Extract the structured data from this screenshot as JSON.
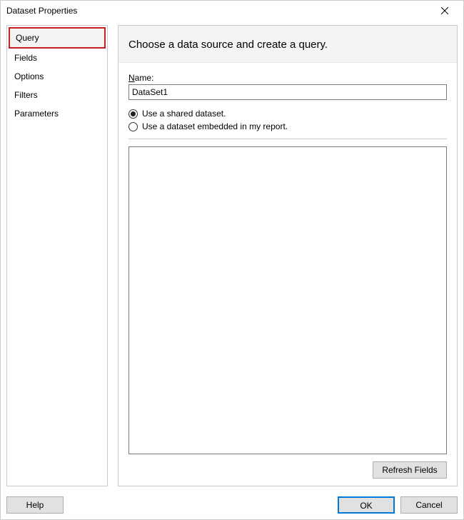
{
  "window": {
    "title": "Dataset Properties"
  },
  "sidebar": {
    "items": [
      {
        "label": "Query",
        "selected": true
      },
      {
        "label": "Fields",
        "selected": false
      },
      {
        "label": "Options",
        "selected": false
      },
      {
        "label": "Filters",
        "selected": false
      },
      {
        "label": "Parameters",
        "selected": false
      }
    ]
  },
  "main": {
    "header": "Choose a data source and create a query.",
    "name_label_prefix_underlined": "N",
    "name_label_rest": "ame:",
    "name_value": "DataSet1",
    "radio_shared": "Use a shared dataset.",
    "radio_embedded": "Use a dataset embedded in my report.",
    "refresh_label_prefix_underlined": "R",
    "refresh_label_rest": "efresh Fields"
  },
  "footer": {
    "help": "Help",
    "ok": "OK",
    "cancel": "Cancel"
  }
}
